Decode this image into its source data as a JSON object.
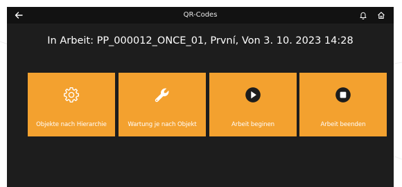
{
  "header": {
    "title": "QR-Codes",
    "back_icon": "arrow-left-icon",
    "notification_icon": "bell-icon",
    "home_icon": "home-icon"
  },
  "status_text": "In Arbeit: PP_000012_ONCE_01, První, Von 3. 10. 2023 14:28",
  "tiles": [
    {
      "label": "Objekte nach Hierarchie",
      "icon": "gear-icon"
    },
    {
      "label": "Wartung je nach Objekt",
      "icon": "wrench-icon"
    },
    {
      "label": "Arbeit beginen",
      "icon": "play-circle-icon"
    },
    {
      "label": "Arbeit beenden",
      "icon": "stop-circle-icon"
    }
  ],
  "colors": {
    "background": "#1d1d1d",
    "header": "#121212",
    "tile": "#f3a12f",
    "text": "#ffffff"
  }
}
